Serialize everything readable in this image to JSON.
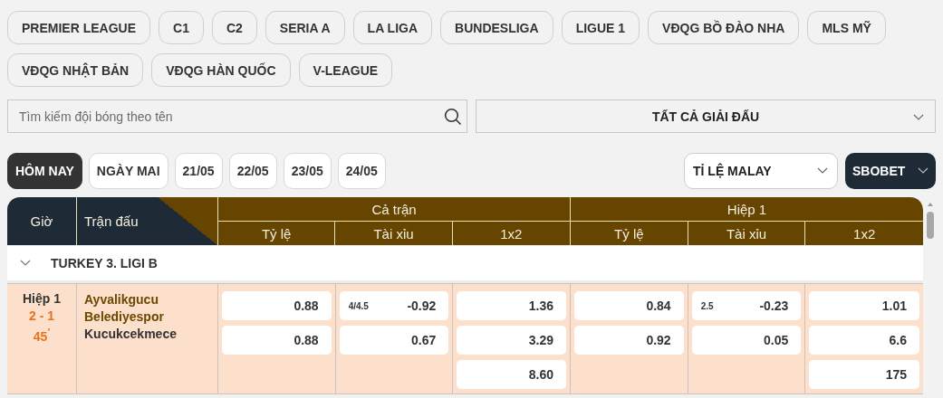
{
  "league_tabs": [
    "PREMIER LEAGUE",
    "C1",
    "C2",
    "SERIA A",
    "LA LIGA",
    "BUNDESLIGA",
    "LIGUE 1",
    "VĐQG BỒ ĐÀO NHA",
    "MLS MỸ",
    "VĐQG NHẬT BẢN",
    "VĐQG HÀN QUỐC",
    "V-LEAGUE"
  ],
  "search": {
    "placeholder": "Tìm kiếm đội bóng theo tên"
  },
  "league_select": {
    "value": "TẤT CẢ GIẢI ĐẤU"
  },
  "date_tabs": [
    {
      "label": "HÔM NAY",
      "selected": true
    },
    {
      "label": "NGÀY MAI",
      "selected": false
    },
    {
      "label": "21/05",
      "selected": false
    },
    {
      "label": "22/05",
      "selected": false
    },
    {
      "label": "23/05",
      "selected": false
    },
    {
      "label": "24/05",
      "selected": false
    }
  ],
  "odds_format": {
    "value": "TỈ LỆ MALAY"
  },
  "bookmaker": {
    "value": "SBOBET"
  },
  "table": {
    "columns": {
      "time": "Giờ",
      "match": "Trận đấu"
    },
    "groups": [
      {
        "title": "Cả trận",
        "columns": [
          "Tỷ lệ",
          "Tài xỉu",
          "1x2"
        ]
      },
      {
        "title": "Hiệp 1",
        "columns": [
          "Tỷ lệ",
          "Tài xỉu",
          "1x2"
        ]
      }
    ],
    "leagues": [
      {
        "name": "TURKEY 3. LIGI B",
        "expanded": true,
        "matches": [
          {
            "status": "Hiệp 1",
            "score": "2 - 1",
            "minute": "45$^{'}$",
            "home": "Ayvalikgucu Belediyespor",
            "away": "Kucukcekmece",
            "markets": [
              [
                {
                  "value": "0.88"
                },
                {
                  "value": "0.88"
                }
              ],
              [
                {
                  "line": "4/4.5",
                  "value": "-0.92"
                },
                {
                  "value": "0.67"
                }
              ],
              [
                {
                  "value": "1.36"
                },
                {
                  "value": "3.29"
                },
                {
                  "value": "8.60"
                }
              ],
              [
                {
                  "value": "0.84"
                },
                {
                  "value": "0.92"
                }
              ],
              [
                {
                  "line": "2.5",
                  "value": "-0.23"
                },
                {
                  "value": "0.05"
                }
              ],
              [
                {
                  "value": "1.01"
                },
                {
                  "value": "6.6"
                },
                {
                  "value": "175"
                }
              ]
            ]
          }
        ]
      }
    ]
  }
}
